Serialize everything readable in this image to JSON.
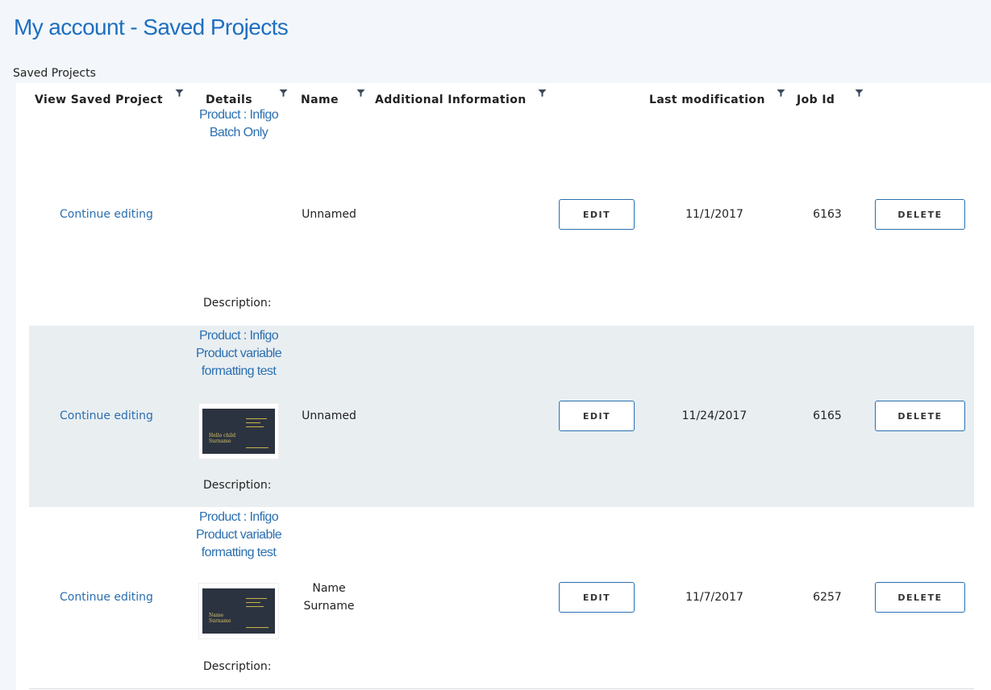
{
  "page": {
    "title": "My account - Saved Projects",
    "section_label": "Saved Projects"
  },
  "table": {
    "columns": [
      "View Saved Project",
      "Details",
      "Name",
      "Additional Information",
      "Last modification",
      "Job Id"
    ],
    "rows": [
      {
        "view_link": "Continue editing",
        "product": "Product : Infigo Batch Only",
        "has_thumbnail": false,
        "description_label": "Description:",
        "name": "Unnamed",
        "edit_label": "EDIT",
        "last_modification": "11/1/2017",
        "job_id": "6163",
        "delete_label": "DELETE"
      },
      {
        "view_link": "Continue editing",
        "product": "Product : Infigo Product variable formatting test",
        "has_thumbnail": true,
        "thumbnail_text": "Hello child Surname",
        "description_label": "Description:",
        "name": "Unnamed",
        "edit_label": "EDIT",
        "last_modification": "11/24/2017",
        "job_id": "6165",
        "delete_label": "DELETE"
      },
      {
        "view_link": "Continue editing",
        "product": "Product : Infigo Product variable formatting test",
        "has_thumbnail": true,
        "thumbnail_text": "Name Surname",
        "description_label": "Description:",
        "name": "Name Surname",
        "edit_label": "EDIT",
        "last_modification": "11/7/2017",
        "job_id": "6257",
        "delete_label": "DELETE"
      }
    ]
  },
  "colors": {
    "accent": "#2a6fb0",
    "title": "#1f6fbf",
    "alt_row": "#e9eef1",
    "page_bg": "#f3f7fb"
  },
  "icons": {
    "filter": "filter-icon"
  }
}
